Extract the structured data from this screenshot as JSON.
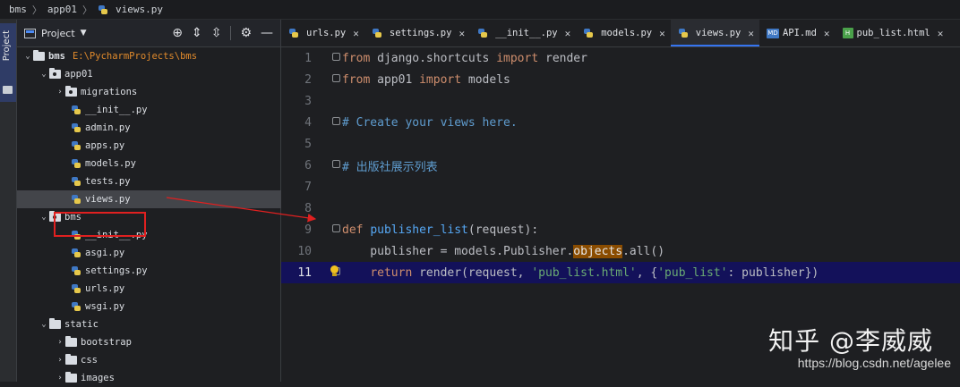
{
  "breadcrumb": {
    "items": [
      "bms",
      "app01",
      "views.py"
    ]
  },
  "tool_strip": {
    "project_label": "Project"
  },
  "project_panel": {
    "title": "Project",
    "tree": [
      {
        "label": "bms",
        "path": "E:\\PycharmProjects\\bms",
        "kind": "root"
      },
      {
        "label": "app01",
        "kind": "package"
      },
      {
        "label": "migrations",
        "kind": "package"
      },
      {
        "label": "__init__.py",
        "kind": "py"
      },
      {
        "label": "admin.py",
        "kind": "py"
      },
      {
        "label": "apps.py",
        "kind": "py"
      },
      {
        "label": "models.py",
        "kind": "py"
      },
      {
        "label": "tests.py",
        "kind": "py"
      },
      {
        "label": "views.py",
        "kind": "py",
        "selected": true
      },
      {
        "label": "bms",
        "kind": "package"
      },
      {
        "label": "__init__.py",
        "kind": "py"
      },
      {
        "label": "asgi.py",
        "kind": "py"
      },
      {
        "label": "settings.py",
        "kind": "py"
      },
      {
        "label": "urls.py",
        "kind": "py"
      },
      {
        "label": "wsgi.py",
        "kind": "py"
      },
      {
        "label": "static",
        "kind": "folder"
      },
      {
        "label": "bootstrap",
        "kind": "folder"
      },
      {
        "label": "css",
        "kind": "folder"
      },
      {
        "label": "images",
        "kind": "folder"
      }
    ]
  },
  "tabs": [
    {
      "label": "urls.py",
      "icon": "python-file-icon"
    },
    {
      "label": "settings.py",
      "icon": "python-file-icon"
    },
    {
      "label": "__init__.py",
      "icon": "python-file-icon"
    },
    {
      "label": "models.py",
      "icon": "python-file-icon"
    },
    {
      "label": "views.py",
      "icon": "python-file-icon",
      "active": true
    },
    {
      "label": "API.md",
      "icon": "markdown-file-icon"
    },
    {
      "label": "pub_list.html",
      "icon": "html-file-icon"
    }
  ],
  "editor": {
    "current_line": 11,
    "lines": [
      {
        "n": "1",
        "tokens": [
          {
            "t": "from",
            "c": "kw"
          },
          {
            "t": " django.shortcuts ",
            "c": ""
          },
          {
            "t": "import",
            "c": "kw"
          },
          {
            "t": " render",
            "c": ""
          }
        ]
      },
      {
        "n": "2",
        "tokens": [
          {
            "t": "from",
            "c": "kw"
          },
          {
            "t": " app01 ",
            "c": ""
          },
          {
            "t": "import",
            "c": "kw"
          },
          {
            "t": " models",
            "c": ""
          }
        ]
      },
      {
        "n": "3",
        "tokens": []
      },
      {
        "n": "4",
        "tokens": [
          {
            "t": "# Create your views here.",
            "c": "cmt-blue"
          }
        ]
      },
      {
        "n": "5",
        "tokens": []
      },
      {
        "n": "6",
        "tokens": [
          {
            "t": "# 出版社展示列表",
            "c": "cmt-blue"
          }
        ]
      },
      {
        "n": "7",
        "tokens": []
      },
      {
        "n": "8",
        "tokens": []
      },
      {
        "n": "9",
        "tokens": [
          {
            "t": "def ",
            "c": "kw"
          },
          {
            "t": "publisher_list",
            "c": "fn"
          },
          {
            "t": "(request):",
            "c": ""
          }
        ]
      },
      {
        "n": "10",
        "tokens": [
          {
            "t": "    publisher = models.Publisher.",
            "c": ""
          },
          {
            "t": "objects",
            "c": "hl"
          },
          {
            "t": ".all()",
            "c": ""
          }
        ]
      },
      {
        "n": "11",
        "tokens": [
          {
            "t": "    ",
            "c": ""
          },
          {
            "t": "return",
            "c": "kw"
          },
          {
            "t": " render(request, ",
            "c": ""
          },
          {
            "t": "'pub_list.html'",
            "c": "str"
          },
          {
            "t": ", {",
            "c": ""
          },
          {
            "t": "'pub_list'",
            "c": "str"
          },
          {
            "t": ": publisher})",
            "c": ""
          }
        ]
      }
    ]
  },
  "watermark": {
    "text": "知乎 @李威威",
    "url": "https://blog.csdn.net/agelee"
  },
  "colors": {
    "accent": "#3574f0",
    "annotation": "#e02020",
    "current_line": "#13115a"
  }
}
